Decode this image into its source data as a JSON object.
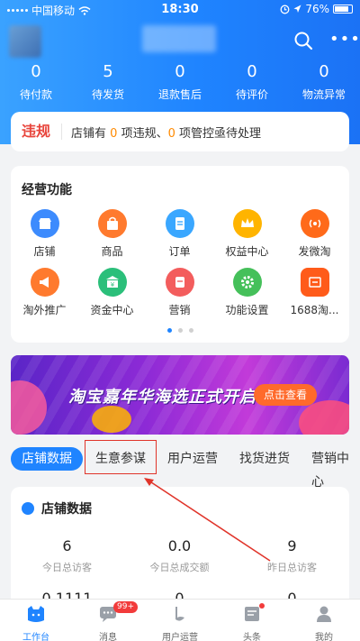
{
  "statusbar": {
    "carrier": "中国移动",
    "time": "18:30",
    "battery": "76%"
  },
  "orders": [
    {
      "count": "0",
      "label": "待付款"
    },
    {
      "count": "5",
      "label": "待发货"
    },
    {
      "count": "0",
      "label": "退款售后"
    },
    {
      "count": "0",
      "label": "待评价"
    },
    {
      "count": "0",
      "label": "物流异常"
    }
  ],
  "violation": {
    "tag": "违规",
    "text_before": "店铺有 ",
    "violations": "0",
    "text_mid": " 项违规、",
    "pending": "0",
    "text_after": " 项管控亟待处理"
  },
  "functions": {
    "title": "经营功能",
    "items": [
      {
        "label": "店铺",
        "icon": "store-icon",
        "color": "#3d8bfd"
      },
      {
        "label": "商品",
        "icon": "goods-bag-icon",
        "color": "#ff7a2e"
      },
      {
        "label": "订单",
        "icon": "order-icon",
        "color": "#3aa7ff"
      },
      {
        "label": "权益中心",
        "icon": "crown-icon",
        "color": "#ffb400"
      },
      {
        "label": "发微淘",
        "icon": "broadcast-icon",
        "color": "#ff6a1a"
      },
      {
        "label": "淘外推广",
        "icon": "megaphone-icon",
        "color": "#ff7a2e"
      },
      {
        "label": "资金中心",
        "icon": "wallet-icon",
        "color": "#2bbf7a"
      },
      {
        "label": "营销",
        "icon": "marketing-icon",
        "color": "#f35d5d"
      },
      {
        "label": "功能设置",
        "icon": "gear-icon",
        "color": "#45c05a"
      },
      {
        "label": "1688淘...",
        "icon": "cargo-icon",
        "color": "#ff5b1a"
      }
    ]
  },
  "banner": {
    "text": "淘宝嘉年华海选正式开启",
    "button": "点击查看"
  },
  "tabs": [
    "店铺数据",
    "生意参谋",
    "用户运营",
    "找货进货",
    "营销中心"
  ],
  "stats": {
    "title": "店铺数据",
    "items": [
      {
        "value": "6",
        "label": "今日总访客"
      },
      {
        "value": "0.0",
        "label": "今日总成交额"
      },
      {
        "value": "9",
        "label": "昨日总访客"
      },
      {
        "value": "0.1111",
        "label": ""
      },
      {
        "value": "0",
        "label": ""
      },
      {
        "value": "0",
        "label": ""
      }
    ]
  },
  "tabbar": [
    {
      "label": "工作台",
      "badge": ""
    },
    {
      "label": "消息",
      "badge": "99+"
    },
    {
      "label": "用户运营",
      "badge": ""
    },
    {
      "label": "头条",
      "badge": ""
    },
    {
      "label": "我的",
      "badge": ""
    }
  ],
  "colors": {
    "primary": "#1f84ff",
    "alert": "#e8453c",
    "highlight": "#ff8a00"
  }
}
